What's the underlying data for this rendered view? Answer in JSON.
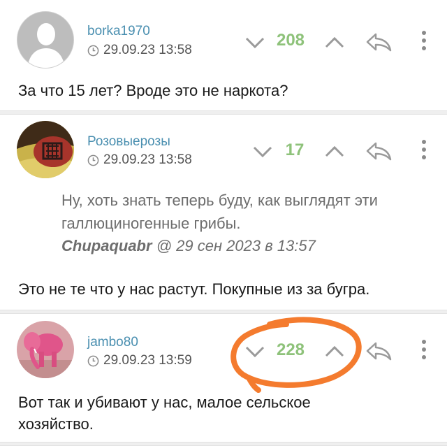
{
  "comments": [
    {
      "username": "borka1970",
      "timestamp": "29.09.23 13:58",
      "score": "208",
      "text": "За что 15 лет? Вроде это не наркота?",
      "avatar_icon": "default-user-silhouette"
    },
    {
      "username": "Розовыерозы",
      "timestamp": "29.09.23 13:58",
      "score": "17",
      "quote": {
        "line1": "Ну, хоть знать теперь буду, как выглядят эти",
        "line2": "галлюциногенные грибы.",
        "author": "Chupaquabr",
        "meta": "@ 29 сен 2023 в 13:57"
      },
      "text": "Это не те что у нас растут. Покупные из за бугра.",
      "avatar_icon": "tattoo-photo"
    },
    {
      "username": "jambo80",
      "timestamp": "29.09.23 13:59",
      "score": "228",
      "text_line1": "Вот так и убивают у нас, малое сельское",
      "text_line2": "хозяйство.",
      "avatar_icon": "pink-elephant-photo"
    }
  ],
  "colors": {
    "username": "#4a8fb0",
    "score": "#8ec27a",
    "highlight": "#f47b2e",
    "text": "#1a1a1a",
    "quote": "#6d6d6d"
  }
}
